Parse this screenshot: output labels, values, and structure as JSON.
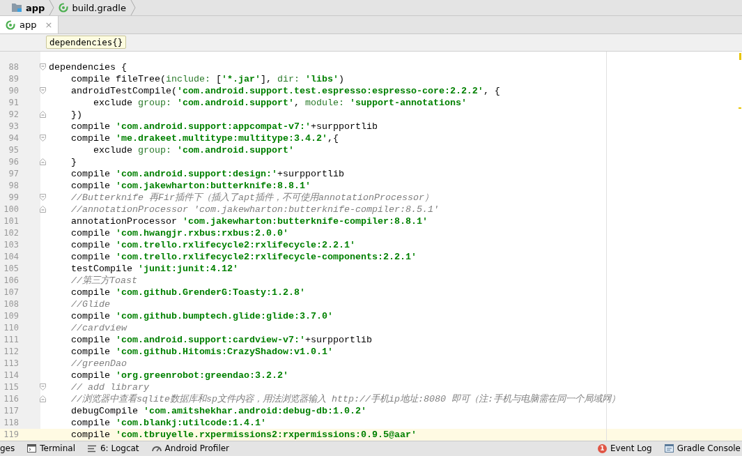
{
  "navbar": [
    {
      "kind": "folder",
      "label": "app"
    },
    {
      "kind": "gradle",
      "label": "build.gradle"
    }
  ],
  "tabs": [
    {
      "label": "app",
      "close": "×",
      "selected": true
    }
  ],
  "breadcrumb": "dependencies{}",
  "lines": [
    {
      "n": "88",
      "gutter": {
        "kind": "fold_start"
      },
      "current": false,
      "parts": [
        {
          "kind": "plain",
          "text": "dependencies {"
        }
      ],
      "children": [
        {
          "n": "89",
          "current": false,
          "parts": [
            {
              "kind": "plain",
              "text": "compile fileTree("
            },
            {
              "kind": "named_arg",
              "text": "include: "
            },
            {
              "kind": "plain",
              "text": "["
            },
            {
              "kind": "string",
              "text": "'*.jar'"
            },
            {
              "kind": "plain",
              "text": "], "
            },
            {
              "kind": "named_arg",
              "text": "dir: "
            },
            {
              "kind": "string",
              "text": "'libs'"
            },
            {
              "kind": "plain",
              "text": ")"
            }
          ]
        },
        {
          "n": "90",
          "gutter": {
            "kind": "fold_start"
          },
          "current": false,
          "parts": [
            {
              "kind": "plain",
              "text": "androidTestCompile("
            },
            {
              "kind": "string",
              "text": "'com.android.support.test.espresso:espresso-core:2.2.2'"
            },
            {
              "kind": "plain",
              "text": ", {"
            }
          ],
          "children": [
            {
              "n": "91",
              "current": false,
              "parts": [
                {
                  "kind": "plain",
                  "text": "exclude "
                },
                {
                  "kind": "named_arg",
                  "text": "group: "
                },
                {
                  "kind": "string",
                  "text": "'com.android.support'"
                },
                {
                  "kind": "plain",
                  "text": ", "
                },
                {
                  "kind": "named_arg",
                  "text": "module: "
                },
                {
                  "kind": "string",
                  "text": "'support-annotations'"
                }
              ]
            }
          ]
        },
        {
          "n": "92",
          "gutter": {
            "kind": "fold_end"
          },
          "current": false,
          "parts": [
            {
              "kind": "plain",
              "text": "})"
            }
          ]
        },
        {
          "n": "93",
          "current": false,
          "parts": [
            {
              "kind": "plain",
              "text": "compile "
            },
            {
              "kind": "string",
              "text": "'com.android.support:appcompat-v7:'"
            },
            {
              "kind": "plain",
              "text": "+surpportlib"
            }
          ]
        },
        {
          "n": "94",
          "gutter": {
            "kind": "fold_start"
          },
          "current": false,
          "parts": [
            {
              "kind": "plain",
              "text": "compile "
            },
            {
              "kind": "string",
              "text": "'me.drakeet.multitype:multitype:3.4.2'"
            },
            {
              "kind": "plain",
              "text": ",{"
            }
          ],
          "children": [
            {
              "n": "95",
              "current": false,
              "parts": [
                {
                  "kind": "plain",
                  "text": "exclude "
                },
                {
                  "kind": "named_arg",
                  "text": "group: "
                },
                {
                  "kind": "string",
                  "text": "'com.android.support'"
                }
              ]
            }
          ]
        },
        {
          "n": "96",
          "gutter": {
            "kind": "fold_end"
          },
          "current": false,
          "parts": [
            {
              "kind": "plain",
              "text": "}"
            }
          ]
        },
        {
          "n": "97",
          "current": false,
          "parts": [
            {
              "kind": "plain",
              "text": "compile "
            },
            {
              "kind": "string",
              "text": "'com.android.support:design:'"
            },
            {
              "kind": "plain",
              "text": "+surpportlib"
            }
          ]
        },
        {
          "n": "98",
          "current": false,
          "parts": [
            {
              "kind": "plain",
              "text": "compile "
            },
            {
              "kind": "string",
              "text": "'com.jakewharton:butterknife:8.8.1'"
            }
          ]
        },
        {
          "n": "99",
          "gutter": {
            "kind": "fold_start"
          },
          "current": false,
          "parts": [
            {
              "kind": "comment",
              "text": "//Butterknife 再Fir插件下（插入了apt插件，不可使用annotationProcessor）"
            }
          ]
        },
        {
          "n": "100",
          "gutter": {
            "kind": "fold_end"
          },
          "current": false,
          "parts": [
            {
              "kind": "comment",
              "text": "//annotationProcessor 'com.jakewharton:butterknife-compiler:8.5.1'"
            }
          ]
        },
        {
          "n": "101",
          "current": false,
          "parts": [
            {
              "kind": "plain",
              "text": "annotationProcessor "
            },
            {
              "kind": "string",
              "text": "'com.jakewharton:butterknife-compiler:8.8.1'"
            }
          ]
        },
        {
          "n": "102",
          "current": false,
          "parts": [
            {
              "kind": "plain",
              "text": "compile "
            },
            {
              "kind": "string",
              "text": "'com.hwangjr.rxbus:rxbus:2.0.0'"
            }
          ]
        },
        {
          "n": "103",
          "current": false,
          "parts": [
            {
              "kind": "plain",
              "text": "compile "
            },
            {
              "kind": "string",
              "text": "'com.trello.rxlifecycle2:rxlifecycle:2.2.1'"
            }
          ]
        },
        {
          "n": "104",
          "current": false,
          "parts": [
            {
              "kind": "plain",
              "text": "compile "
            },
            {
              "kind": "string",
              "text": "'com.trello.rxlifecycle2:rxlifecycle-components:2.2.1'"
            }
          ]
        },
        {
          "n": "105",
          "current": false,
          "parts": [
            {
              "kind": "plain",
              "text": "testCompile "
            },
            {
              "kind": "string",
              "text": "'junit:junit:4.12'"
            }
          ]
        },
        {
          "n": "106",
          "current": false,
          "parts": [
            {
              "kind": "comment",
              "text": "//第三方Toast"
            }
          ]
        },
        {
          "n": "107",
          "current": false,
          "parts": [
            {
              "kind": "plain",
              "text": "compile "
            },
            {
              "kind": "string",
              "text": "'com.github.GrenderG:Toasty:1.2.8'"
            }
          ]
        },
        {
          "n": "108",
          "current": false,
          "parts": [
            {
              "kind": "comment",
              "text": "//Glide"
            }
          ]
        },
        {
          "n": "109",
          "current": false,
          "parts": [
            {
              "kind": "plain",
              "text": "compile "
            },
            {
              "kind": "string",
              "text": "'com.github.bumptech.glide:glide:3.7.0'"
            }
          ]
        },
        {
          "n": "110",
          "current": false,
          "parts": [
            {
              "kind": "comment",
              "text": "//cardview"
            }
          ]
        },
        {
          "n": "111",
          "current": false,
          "parts": [
            {
              "kind": "plain",
              "text": "compile "
            },
            {
              "kind": "string",
              "text": "'com.android.support:cardview-v7:'"
            },
            {
              "kind": "plain",
              "text": "+surpportlib"
            }
          ]
        },
        {
          "n": "112",
          "current": false,
          "parts": [
            {
              "kind": "plain",
              "text": "compile "
            },
            {
              "kind": "string",
              "text": "'com.github.Hitomis:CrazyShadow:v1.0.1'"
            }
          ]
        },
        {
          "n": "113",
          "current": false,
          "parts": [
            {
              "kind": "comment",
              "text": "//greenDao"
            }
          ]
        },
        {
          "n": "114",
          "current": false,
          "parts": [
            {
              "kind": "plain",
              "text": "compile "
            },
            {
              "kind": "string",
              "text": "'org.greenrobot:greendao:3.2.2'"
            }
          ]
        },
        {
          "n": "115",
          "gutter": {
            "kind": "fold_start"
          },
          "current": false,
          "parts": [
            {
              "kind": "comment",
              "text": "// add library"
            }
          ]
        },
        {
          "n": "116",
          "gutter": {
            "kind": "fold_end"
          },
          "current": false,
          "parts": [
            {
              "kind": "comment",
              "text": "//浏览器中查看sqlite数据库和sp文件内容，用法浏览器输入 http://手机ip地址:8080 即可（注:手机与电脑需在同一个局域网）"
            }
          ]
        },
        {
          "n": "117",
          "current": false,
          "parts": [
            {
              "kind": "plain",
              "text": "debugCompile "
            },
            {
              "kind": "string",
              "text": "'com.amitshekhar.android:debug-db:1.0.2'"
            }
          ]
        },
        {
          "n": "118",
          "current": false,
          "parts": [
            {
              "kind": "plain",
              "text": "compile "
            },
            {
              "kind": "string",
              "text": "'com.blankj:utilcode:1.4.1'"
            }
          ]
        },
        {
          "n": "119",
          "current": true,
          "parts": [
            {
              "kind": "plain",
              "text": "compile "
            },
            {
              "kind": "string",
              "text": "'com.tbruyelle.rxpermissions2:rxpermissions:0.9.5@aar'"
            }
          ]
        }
      ]
    }
  ],
  "status_left": [
    {
      "kind": "none",
      "label": "ges"
    },
    {
      "kind": "terminal",
      "label": "Terminal"
    },
    {
      "kind": "logcat",
      "label": "6: Logcat"
    },
    {
      "kind": "profiler",
      "label": "Android Profiler"
    }
  ],
  "status_right": [
    {
      "kind": "event",
      "label": "Event Log",
      "badge": "1"
    },
    {
      "kind": "console",
      "label": "Gradle Console"
    }
  ]
}
